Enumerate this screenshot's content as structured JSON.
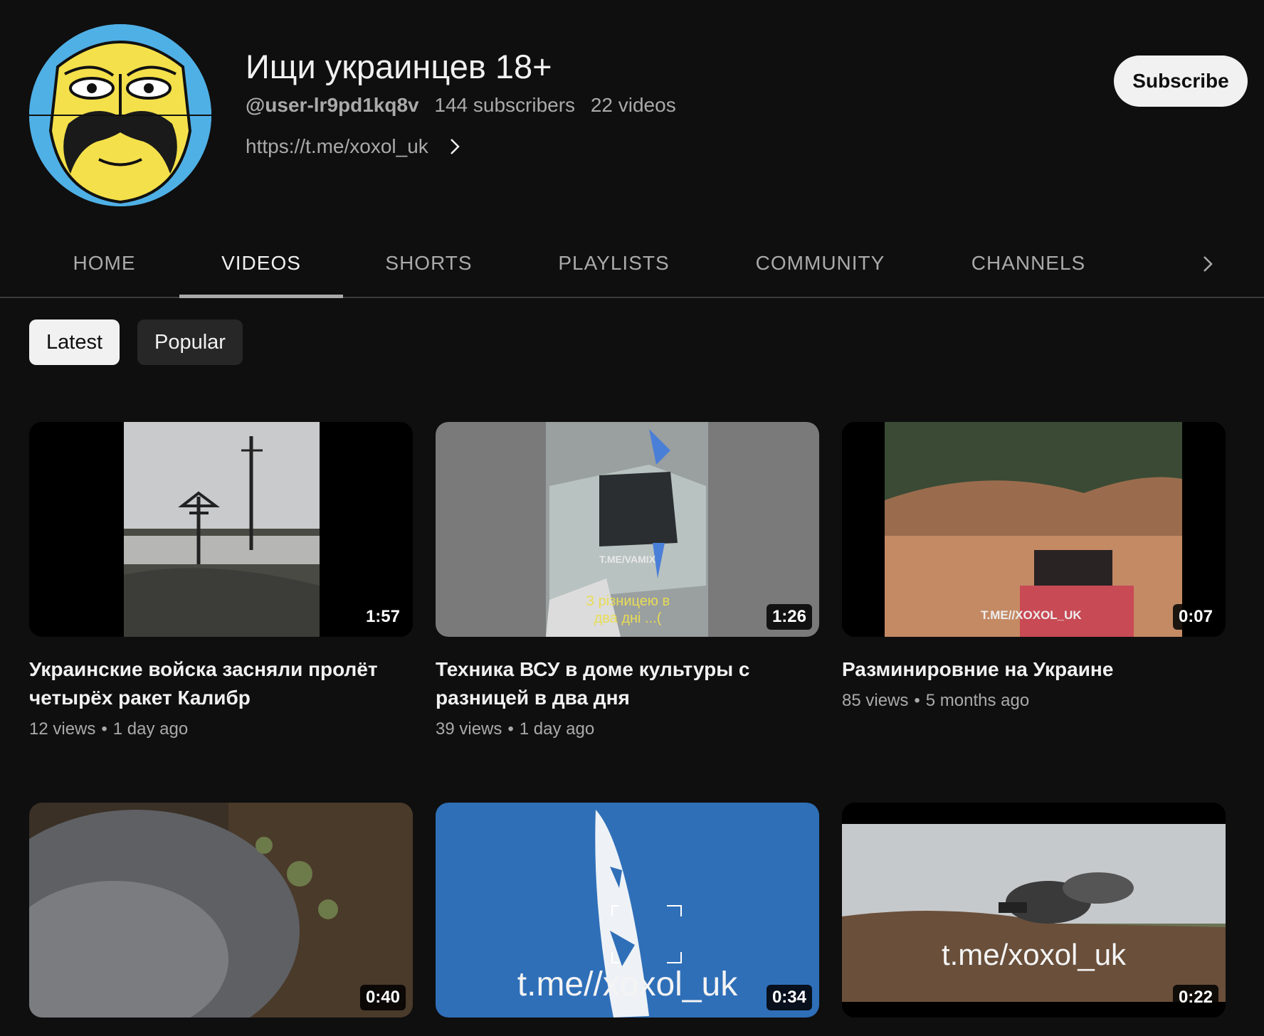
{
  "channel": {
    "title": "Ищи украинцев 18+",
    "handle": "@user-lr9pd1kq8v",
    "subscribers": "144 subscribers",
    "videos_count": "22 videos",
    "link": "https://t.me/xoxol_uk",
    "subscribe_label": "Subscribe"
  },
  "tabs": [
    {
      "label": "HOME",
      "active": false
    },
    {
      "label": "VIDEOS",
      "active": true
    },
    {
      "label": "SHORTS",
      "active": false
    },
    {
      "label": "PLAYLISTS",
      "active": false
    },
    {
      "label": "COMMUNITY",
      "active": false
    },
    {
      "label": "CHANNELS",
      "active": false
    }
  ],
  "chips": [
    {
      "label": "Latest",
      "active": true
    },
    {
      "label": "Popular",
      "active": false
    }
  ],
  "videos": [
    {
      "title": "Украинские войска засняли пролёт четырёх ракет Калибр",
      "duration": "1:57",
      "views": "12 views",
      "age": "1 day ago"
    },
    {
      "title": "Техника ВСУ в доме культуры с разницей в два дня",
      "duration": "1:26",
      "views": "39 views",
      "age": "1 day ago",
      "thumb_caption": "З різницею в два дні ...(",
      "thumb_watermark": "T.ME/VAMIX"
    },
    {
      "title": "Разминировние на Украине",
      "duration": "0:07",
      "views": "85 views",
      "age": "5 months ago",
      "thumb_watermark": "T.ME//XOXOL_UK"
    },
    {
      "title": "",
      "duration": "0:40"
    },
    {
      "title": "",
      "duration": "0:34",
      "thumb_watermark": "t.me//xoxol_uk"
    },
    {
      "title": "",
      "duration": "0:22",
      "thumb_watermark": "t.me/xoxol_uk"
    }
  ],
  "meta_separator": "•"
}
